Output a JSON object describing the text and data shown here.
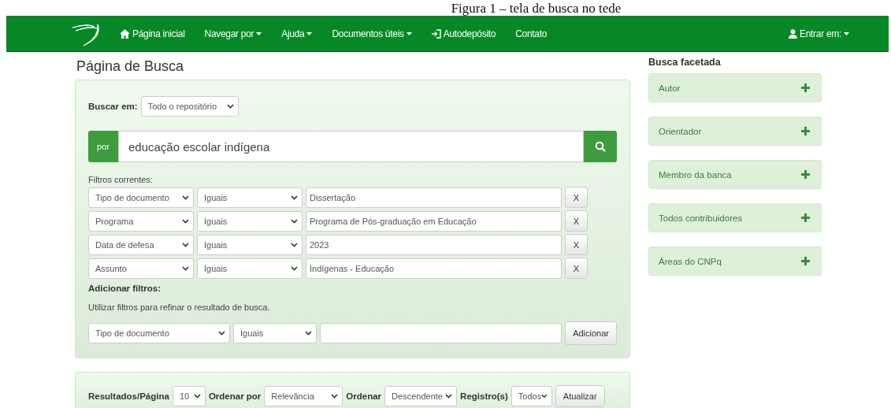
{
  "caption": "Figura 1 – tela de busca no tede",
  "navbar": {
    "items": [
      {
        "label": "Página inicial",
        "kind": "home"
      },
      {
        "label": "Navegar por",
        "kind": "menu"
      },
      {
        "label": "Ajuda",
        "kind": "menu"
      },
      {
        "label": "Documentos úteis",
        "kind": "menu"
      },
      {
        "label": "Autodepósito",
        "kind": "deposit"
      },
      {
        "label": "Contato",
        "kind": "link"
      }
    ],
    "user": {
      "label": "Entrar em:"
    }
  },
  "page_title": "Página de Busca",
  "search": {
    "scope_label": "Buscar em:",
    "scope": "Todo o repositório",
    "prefix": "por",
    "query": "educação escolar indígena"
  },
  "current_filters": {
    "label": "Filtros correntes:",
    "rows": [
      {
        "field": "Tipo de documento",
        "operator": "Iguais",
        "value": "Dissertação",
        "remove": "X"
      },
      {
        "field": "Programa",
        "operator": "Iguais",
        "value": "Programa de Pós-graduação em Educação",
        "remove": "X"
      },
      {
        "field": "Data de defesa",
        "operator": "Iguais",
        "value": "2023",
        "remove": "X"
      },
      {
        "field": "Assunto",
        "operator": "Iguais",
        "value": "Indígenas - Educação",
        "remove": "X"
      }
    ]
  },
  "add_filters": {
    "title": "Adicionar filtros:",
    "hint": "Utilizar filtros para refinar o resultado de busca.",
    "field": "Tipo de documento",
    "operator": "Iguais",
    "button": "Adicionar"
  },
  "results_bar": {
    "per_page_label": "Resultados/Página",
    "per_page": "10",
    "sort_by_label": "Ordenar por",
    "sort_by": "Relevância",
    "order_label": "Ordenar",
    "order": "Descendente",
    "records_label": "Registro(s)",
    "records": "Todos",
    "button": "Atualizar"
  },
  "facets": {
    "title": "Busca facetada",
    "items": [
      {
        "label": "Autor",
        "expanded": false
      },
      {
        "label": "Orientador",
        "expanded": false
      },
      {
        "label": "Membro da banca",
        "expanded": false
      },
      {
        "label": "Todos contribuidores",
        "expanded": false
      },
      {
        "label": "Áreas do CNPq",
        "expanded": false
      }
    ]
  }
}
